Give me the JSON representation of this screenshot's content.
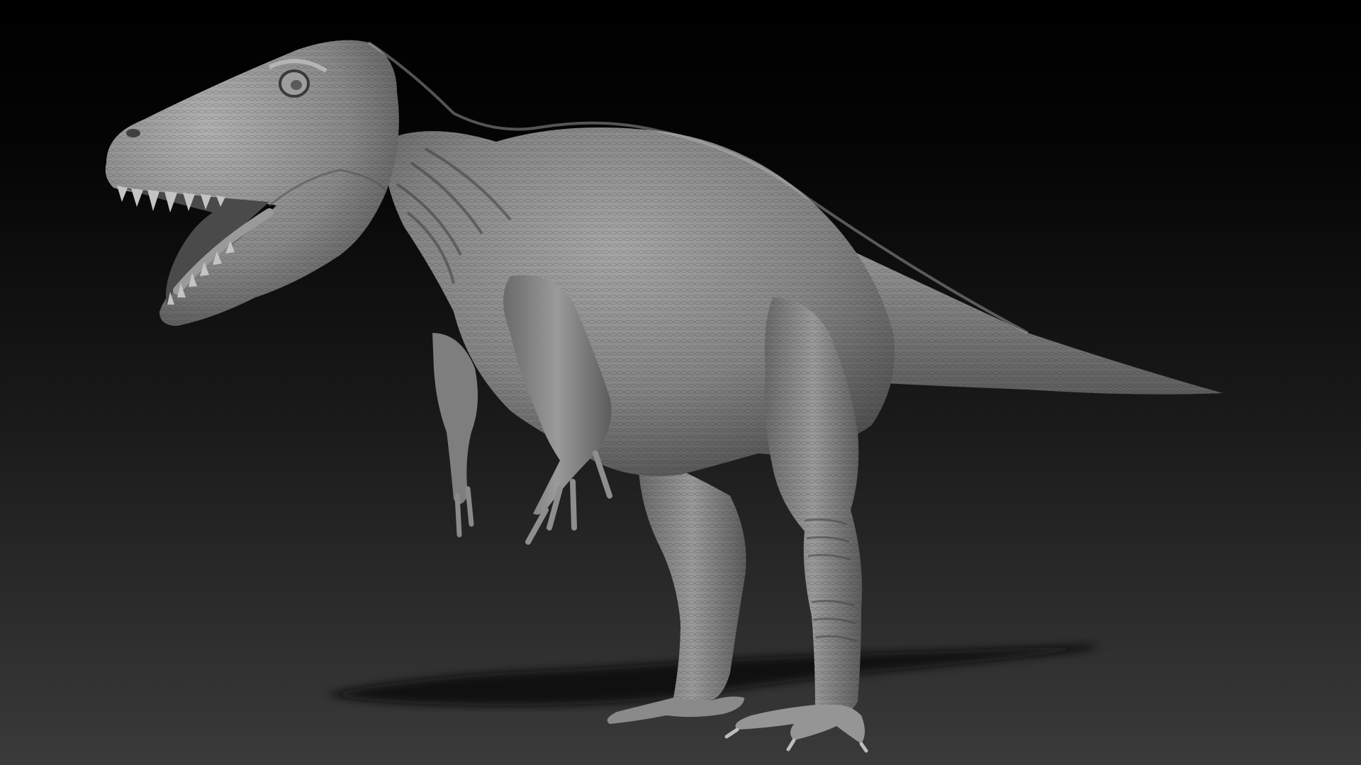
{
  "scene": {
    "subject": "dinosaur-sculpt",
    "background": {
      "top_color": "#000000",
      "bottom_color": "#3a3a3a"
    },
    "model_color": "#8c8c8c",
    "shadow_color": "#0a0a0a"
  }
}
